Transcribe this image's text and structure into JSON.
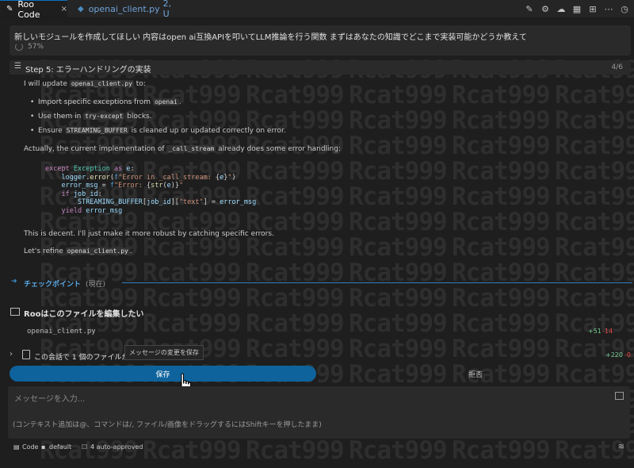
{
  "watermark_text": "Rcat999",
  "tabs": [
    {
      "icon": "roo-icon",
      "label": "Roo Code",
      "close": "×"
    },
    {
      "icon": "python-icon",
      "label": "openai_client.py",
      "status": "2, U"
    }
  ],
  "toolbar_icons": [
    "edit-icon",
    "gear-icon",
    "cloud-icon",
    "extensions-icon",
    "marketplace-icon",
    "more-icon",
    "history-icon"
  ],
  "task": {
    "text": "新しいモジュールを作成してほしい 内容はopen ai互換APIを叩いてLLM推論を行う関数 まずはあなたの知識でどこまで実装可能かどうか教えて",
    "progress": "57%"
  },
  "step": {
    "title": "Step 5: エラーハンドリングの実装",
    "count": "4/6"
  },
  "content": {
    "p1_pre": "I will update",
    "p1_code": "openai_client.py",
    "p1_post": "to:",
    "b1_pre": "Import specific exceptions from",
    "b1_code": "openai",
    "b1_post": ".",
    "b2_pre": "Use them in",
    "b2_code": "try-except",
    "b2_post": "blocks.",
    "b3_pre": "Ensure",
    "b3_code": "STREAMING_BUFFER",
    "b3_post": "is cleaned up or updated correctly on error.",
    "p2_pre": "Actually, the current implementation of",
    "p2_code": "_call_stream",
    "p2_post": "already does some error handling:",
    "code_lines": [
      "except Exception as e:",
      "    logger.error(f\"Error in _call_stream: {e}\")",
      "    error_msg = f\"Error: {str(e)}\"",
      "    if job_id:",
      "        STREAMING_BUFFER[job_id][\"text\"] = error_msg",
      "    yield error_msg"
    ],
    "p3": "This is decent. I'll just make it more robust by catching specific errors.",
    "p4_pre": "Let's refine",
    "p4_code": "openai_client.py",
    "p4_post": "."
  },
  "checkpoint": {
    "label": "チェックポイント",
    "now": "(現在)"
  },
  "edit": {
    "title": "Rooはこのファイルを編集したい",
    "file": "openai_client.py",
    "added": "+51",
    "removed": "-14"
  },
  "files_changed": {
    "text": "この会話で 1 個のファイルが変更されました",
    "added": "+220",
    "removed": "-0",
    "tooltip": "メッセージの変更を保存"
  },
  "buttons": {
    "save": "保存",
    "reject": "拒否"
  },
  "input": {
    "placeholder": "メッセージを入力...",
    "hint": "(コンテキスト追加は@、コマンドは/, ファイル/画像をドラッグするにはShiftキーを押したまま)"
  },
  "status": {
    "mode": "Code",
    "profile": "default",
    "auto_approve": "4 auto-approved"
  }
}
